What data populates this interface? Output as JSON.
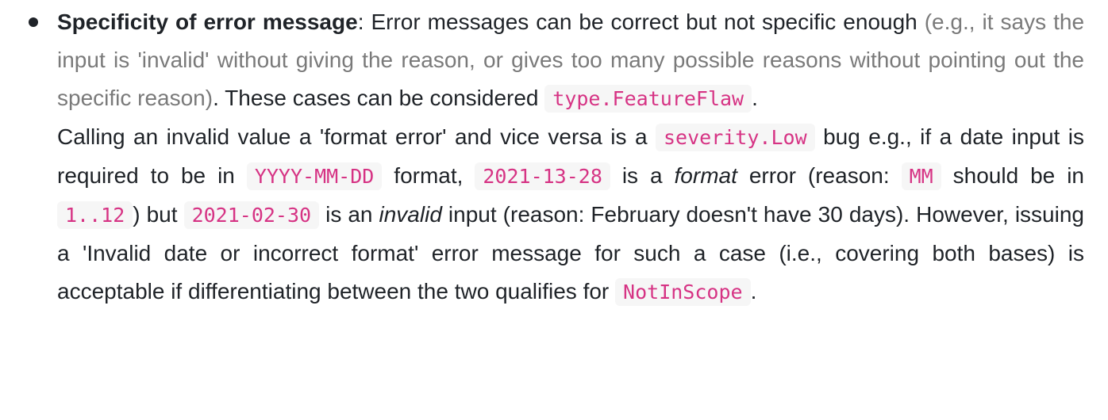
{
  "bullet": {
    "heading": "Specificity of error message",
    "p1_a": ": Error messages can be correct but not specific enough ",
    "p1_muted": "(e.g., it says the input is 'invalid' without giving the reason, or gives too many possible reasons without pointing out the specific reason)",
    "p1_b": ". These cases can be considered ",
    "code_feature_flaw": "type.FeatureFlaw",
    "p1_end": ".",
    "p2_a": "Calling an invalid value a 'format error' and vice versa is a ",
    "code_severity_low": "severity.Low",
    "p2_b": " bug e.g., if a date input is required to be in ",
    "code_format": "YYYY-MM-DD",
    "p2_c": " format, ",
    "code_date1": "2021-13-28",
    "p2_d": " is a ",
    "em_format": "format",
    "p2_e": " error (reason: ",
    "code_mm": "MM",
    "p2_f": " should be in ",
    "code_range": "1..12",
    "p2_g": ") but ",
    "code_date2": "2021-02-30",
    "p2_h": " is an ",
    "em_invalid": "invalid",
    "p2_i": " input (reason: February doesn't have 30 days). However, issuing a 'Invalid date or incorrect format' error message for such a case (i.e., covering both bases) is acceptable if differentiating between the two qualifies for ",
    "code_not_in_scope": "NotInScope",
    "p2_end": "."
  }
}
